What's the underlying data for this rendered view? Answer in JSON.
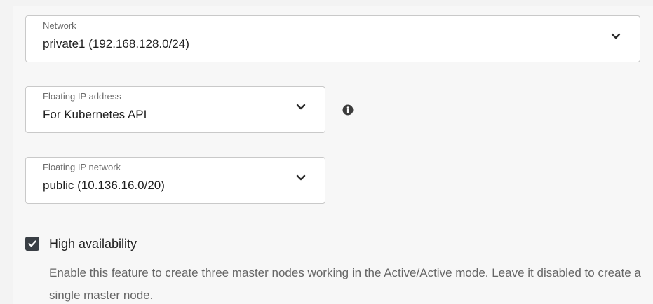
{
  "network": {
    "label": "Network",
    "value": "private1 (192.168.128.0/24)"
  },
  "floating_ip_address": {
    "label": "Floating IP address",
    "value": "For Kubernetes API"
  },
  "floating_ip_network": {
    "label": "Floating IP network",
    "value": "public (10.136.16.0/20)"
  },
  "high_availability": {
    "label": "High availability",
    "checked": true,
    "help": "Enable this feature to create three master nodes working in the Active/Active mode. Leave it disabled to create a single master node."
  },
  "icons": {
    "dropdown": "chevron-down-icon",
    "info": "info-icon",
    "check": "check-icon"
  },
  "colors": {
    "checkbox_fill": "#3a3f45",
    "border": "#c9c9c9",
    "muted_text": "#666666"
  }
}
